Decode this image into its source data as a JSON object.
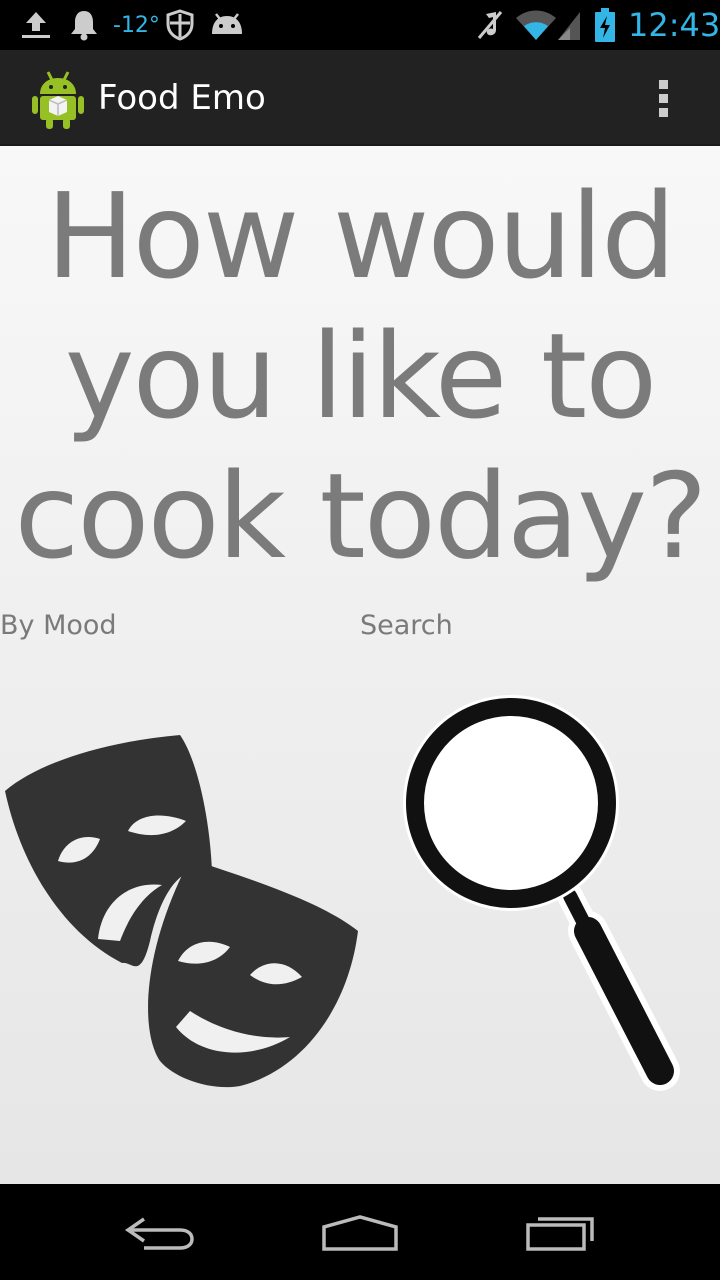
{
  "status_bar": {
    "temperature": "-12°",
    "time": "12:43",
    "icons": [
      "upload-icon",
      "notification-bell-icon",
      "shield-icon",
      "android-robot-icon",
      "mute-icon",
      "wifi-icon",
      "signal-icon",
      "battery-charging-icon"
    ],
    "accent_color": "#33b5e5"
  },
  "action_bar": {
    "title": "Food Emo",
    "icons": [
      "app-launcher-icon",
      "overflow-menu-icon"
    ]
  },
  "main": {
    "headline_lines": [
      "How would",
      "you like to",
      "cook today?"
    ],
    "options": [
      {
        "label": "By Mood",
        "icon": "theater-masks-icon"
      },
      {
        "label": "Search",
        "icon": "magnifying-glass-icon"
      }
    ]
  },
  "nav_bar": {
    "buttons": [
      "back-icon",
      "home-icon",
      "recent-apps-icon"
    ]
  }
}
